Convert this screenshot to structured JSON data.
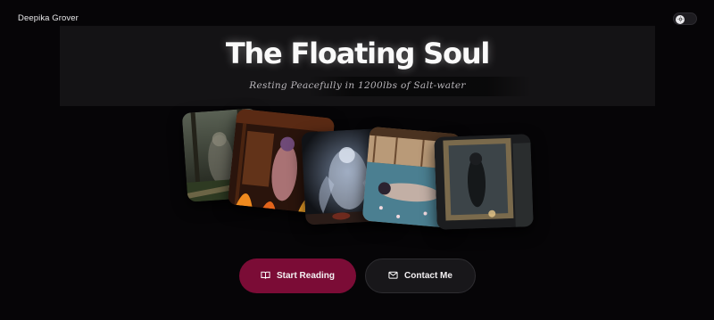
{
  "header": {
    "site_name": "Deepika Grover",
    "theme_toggle_icon": "sun-icon"
  },
  "hero": {
    "title": "The Floating Soul",
    "subtitle": "Resting Peacefully in 1200lbs of Salt-water"
  },
  "gallery": {
    "images": [
      {
        "icon": "forest-ghost-illustration"
      },
      {
        "icon": "burning-house-ghost-illustration"
      },
      {
        "icon": "spectral-figure-illustration"
      },
      {
        "icon": "floating-woman-pool-illustration"
      },
      {
        "icon": "haunted-mirror-illustration"
      }
    ]
  },
  "actions": {
    "start_reading_label": "Start Reading",
    "start_reading_icon": "book-open-icon",
    "contact_label": "Contact Me",
    "contact_icon": "mail-icon"
  },
  "colors": {
    "background": "#060507",
    "primary_button": "#7b0c36",
    "secondary_button": "#18171a",
    "banner": "#141315"
  }
}
